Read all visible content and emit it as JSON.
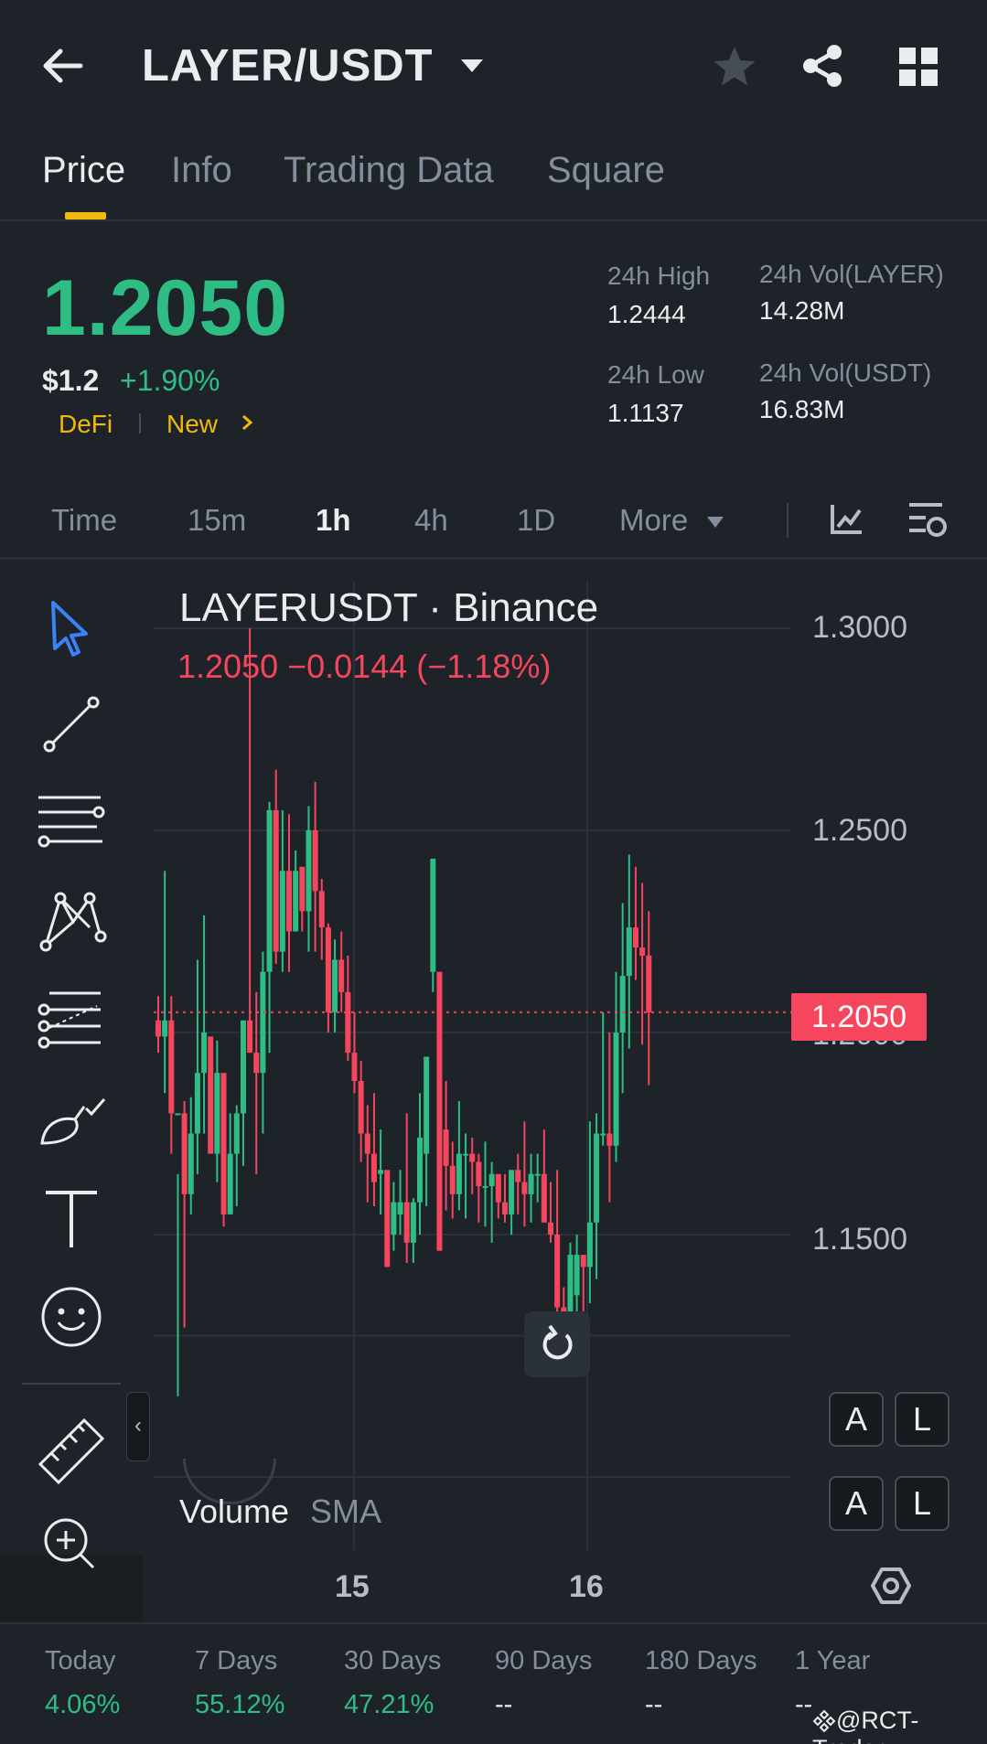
{
  "header": {
    "pair": "LAYER/USDT",
    "tabs": [
      {
        "label": "Price",
        "active": true
      },
      {
        "label": "Info",
        "active": false
      },
      {
        "label": "Trading Data",
        "active": false
      },
      {
        "label": "Square",
        "active": false
      }
    ]
  },
  "price": {
    "last": "1.2050",
    "usd": "$1.2",
    "change_pct": "+1.90%",
    "tags": [
      "DeFi",
      "New"
    ],
    "stats": {
      "high_label": "24h High",
      "high": "1.2444",
      "low_label": "24h Low",
      "low": "1.1137",
      "vol_base_label": "24h Vol(LAYER)",
      "vol_base": "14.28M",
      "vol_quote_label": "24h Vol(USDT)",
      "vol_quote": "16.83M"
    }
  },
  "intervals": {
    "items": [
      "Time",
      "15m",
      "1h",
      "4h",
      "1D",
      "More"
    ],
    "active": "1h"
  },
  "chart": {
    "symbol": "LAYERUSDT · Binance",
    "ohlc": "1.2050  −0.0144 (−1.18%)",
    "current_price_tag": "1.2050",
    "y_labels": [
      "1.3000",
      "1.2500",
      "1.2000",
      "1.1500"
    ],
    "x_labels": [
      "15",
      "16"
    ],
    "volume_label": "Volume",
    "sma_label": "SMA",
    "scale_buttons": [
      [
        "A",
        "L"
      ],
      [
        "A",
        "L"
      ]
    ],
    "colors": {
      "up": "#2ebd85",
      "down": "#f6465d",
      "accent": "#f0b90b"
    }
  },
  "chart_data": {
    "type": "candlestick",
    "title": "LAYERUSDT · Binance",
    "interval": "1h",
    "ylim": [
      1.12,
      1.31
    ],
    "y_ticks": [
      1.3,
      1.25,
      1.2,
      1.15
    ],
    "x_ticks": [
      "15",
      "16"
    ],
    "last_price": 1.205,
    "candles": [
      [
        1.203,
        1.209,
        1.195,
        1.199
      ],
      [
        1.199,
        1.24,
        1.185,
        1.203
      ],
      [
        1.203,
        1.209,
        1.17,
        1.18
      ],
      [
        1.18,
        1.165,
        1.11,
        1.18
      ],
      [
        1.18,
        1.183,
        1.127,
        1.16
      ],
      [
        1.16,
        1.184,
        1.155,
        1.175
      ],
      [
        1.175,
        1.218,
        1.165,
        1.19
      ],
      [
        1.19,
        1.229,
        1.175,
        1.2
      ],
      [
        1.199,
        1.198,
        1.172,
        1.17
      ],
      [
        1.17,
        1.198,
        1.163,
        1.19
      ],
      [
        1.19,
        1.187,
        1.152,
        1.155
      ],
      [
        1.155,
        1.18,
        1.155,
        1.17
      ],
      [
        1.17,
        1.182,
        1.157,
        1.18
      ],
      [
        1.18,
        1.203,
        1.167,
        1.203
      ],
      [
        1.203,
        1.3,
        1.195,
        1.195
      ],
      [
        1.195,
        1.21,
        1.165,
        1.19
      ],
      [
        1.19,
        1.22,
        1.175,
        1.215
      ],
      [
        1.215,
        1.257,
        1.195,
        1.255
      ],
      [
        1.255,
        1.265,
        1.217,
        1.22
      ],
      [
        1.22,
        1.255,
        1.215,
        1.24
      ],
      [
        1.24,
        1.254,
        1.215,
        1.225
      ],
      [
        1.225,
        1.245,
        1.225,
        1.24
      ],
      [
        1.241,
        1.235,
        1.225,
        1.23
      ],
      [
        1.23,
        1.256,
        1.22,
        1.25
      ],
      [
        1.25,
        1.262,
        1.22,
        1.235
      ],
      [
        1.235,
        1.238,
        1.218,
        1.226
      ],
      [
        1.226,
        1.227,
        1.2,
        1.205
      ],
      [
        1.205,
        1.223,
        1.2,
        1.218
      ],
      [
        1.218,
        1.225,
        1.205,
        1.21
      ],
      [
        1.21,
        1.219,
        1.193,
        1.195
      ],
      [
        1.195,
        1.205,
        1.185,
        1.188
      ],
      [
        1.188,
        1.193,
        1.168,
        1.175
      ],
      [
        1.175,
        1.182,
        1.158,
        1.17
      ],
      [
        1.17,
        1.185,
        1.157,
        1.163
      ],
      [
        1.165,
        1.176,
        1.155,
        1.166
      ],
      [
        1.166,
        1.163,
        1.142,
        1.142
      ],
      [
        1.15,
        1.163,
        1.146,
        1.158
      ],
      [
        1.155,
        1.166,
        1.15,
        1.158
      ],
      [
        1.158,
        1.18,
        1.143,
        1.148
      ],
      [
        1.148,
        1.159,
        1.143,
        1.158
      ],
      [
        1.158,
        1.185,
        1.15,
        1.174
      ],
      [
        1.17,
        1.193,
        1.157,
        1.194
      ],
      [
        1.215,
        1.24,
        1.21,
        1.243
      ],
      [
        1.215,
        1.215,
        1.205,
        1.146
      ],
      [
        1.176,
        1.188,
        1.156,
        1.167
      ],
      [
        1.167,
        1.173,
        1.154,
        1.16
      ],
      [
        1.16,
        1.183,
        1.156,
        1.17
      ],
      [
        1.17,
        1.175,
        1.154,
        1.17
      ],
      [
        1.17,
        1.174,
        1.16,
        1.168
      ],
      [
        1.168,
        1.17,
        1.153,
        1.162
      ],
      [
        1.162,
        1.173,
        1.152,
        1.162
      ],
      [
        1.162,
        1.168,
        1.148,
        1.165
      ],
      [
        1.165,
        1.164,
        1.154,
        1.158
      ],
      [
        1.158,
        1.165,
        1.153,
        1.155
      ],
      [
        1.155,
        1.163,
        1.15,
        1.166
      ],
      [
        1.166,
        1.17,
        1.155,
        1.163
      ],
      [
        1.163,
        1.178,
        1.152,
        1.16
      ],
      [
        1.16,
        1.17,
        1.153,
        1.165
      ],
      [
        1.165,
        1.17,
        1.158,
        1.165
      ],
      [
        1.165,
        1.176,
        1.153,
        1.153
      ],
      [
        1.153,
        1.163,
        1.148,
        1.15
      ],
      [
        1.15,
        1.166,
        1.128,
        1.132
      ],
      [
        1.132,
        1.137,
        1.12,
        1.129
      ],
      [
        1.129,
        1.148,
        1.124,
        1.145
      ],
      [
        1.135,
        1.15,
        1.12,
        1.145
      ],
      [
        1.145,
        1.145,
        1.131,
        1.142
      ],
      [
        1.142,
        1.178,
        1.133,
        1.153
      ],
      [
        1.153,
        1.18,
        1.139,
        1.175
      ],
      [
        1.175,
        1.205,
        1.172,
        1.175
      ],
      [
        1.175,
        1.2,
        1.158,
        1.172
      ],
      [
        1.172,
        1.215,
        1.168,
        1.2
      ],
      [
        1.2,
        1.232,
        1.185,
        1.214
      ],
      [
        1.214,
        1.244,
        1.196,
        1.226
      ],
      [
        1.226,
        1.241,
        1.213,
        1.221
      ],
      [
        1.221,
        1.237,
        1.197,
        1.219
      ],
      [
        1.219,
        1.23,
        1.187,
        1.205
      ]
    ]
  },
  "performance": [
    {
      "label": "Today",
      "value": "4.06%",
      "up": true
    },
    {
      "label": "7 Days",
      "value": "55.12%",
      "up": true
    },
    {
      "label": "30 Days",
      "value": "47.21%",
      "up": true
    },
    {
      "label": "90 Days",
      "value": "--",
      "up": false
    },
    {
      "label": "180 Days",
      "value": "--",
      "up": false
    },
    {
      "label": "1 Year",
      "value": "--",
      "up": false
    }
  ],
  "watermark": "@RCT-Trader",
  "icons": {
    "back": "arrow-left-icon",
    "dropdown": "caret-down-icon",
    "favorite": "star-icon",
    "share": "share-icon",
    "menu": "grid-icon",
    "tools": [
      "cursor-icon",
      "trend-line-icon",
      "parallel-lines-icon",
      "pattern-icon",
      "fib-icon",
      "brush-icon",
      "text-icon",
      "emoji-icon",
      "ruler-icon",
      "zoom-in-icon"
    ]
  }
}
